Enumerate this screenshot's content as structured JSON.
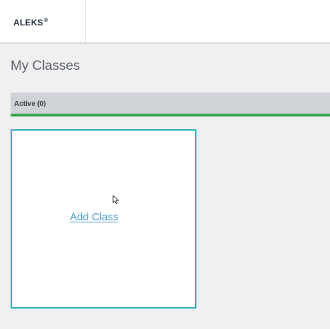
{
  "header": {
    "logo_text": "ALEKS",
    "logo_mark": "®"
  },
  "page": {
    "title": "My Classes"
  },
  "tabs": [
    {
      "label": "Active (0)",
      "selected": true
    }
  ],
  "add_class": {
    "link_label": "Add Class"
  },
  "colors": {
    "card_border": "#29b3c4",
    "link": "#4a9bc9",
    "tab_underline": "#3aa450",
    "tab_background": "#cfd3d7",
    "page_background": "#f0f0f0"
  },
  "icons": {
    "cursor": "mouse-pointer-icon"
  }
}
